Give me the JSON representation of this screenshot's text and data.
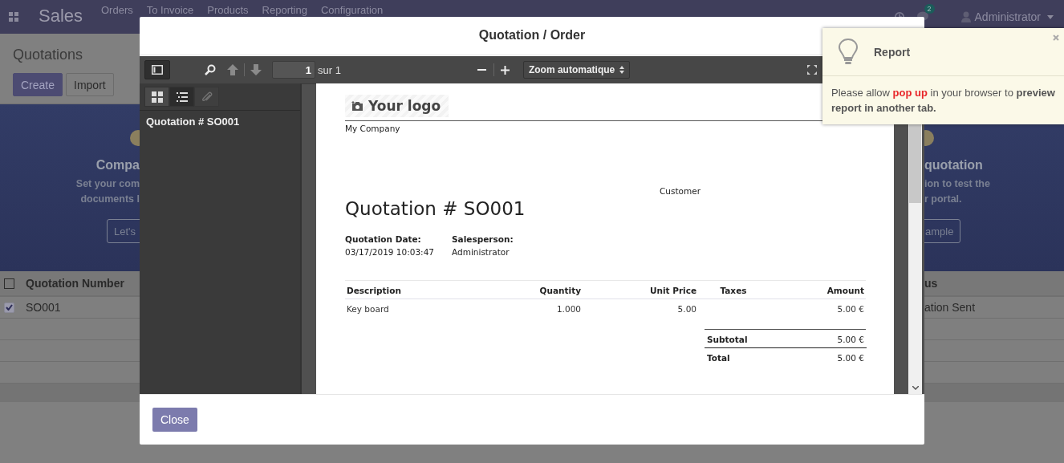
{
  "navbar": {
    "app_name": "Sales",
    "menu": [
      "Orders",
      "To Invoice",
      "Products",
      "Reporting",
      "Configuration"
    ],
    "messages_badge": "2",
    "user": "Administrator"
  },
  "control_panel": {
    "title": "Quotations",
    "buttons": [
      {
        "label": "Create",
        "kind": "primary"
      },
      {
        "label": "Import",
        "kind": "secondary"
      }
    ]
  },
  "banner": {
    "left": {
      "title": "Compa",
      "lines": [
        "Set your com",
        "documents l"
      ],
      "button": "Let's"
    },
    "right": {
      "title": "quotation",
      "lines": [
        "ion to test the",
        "r portal."
      ],
      "button": "ample"
    }
  },
  "list": {
    "select_all": {
      "checked": false
    },
    "column_1": "Quotation Number",
    "column_2": "us",
    "rows": [
      {
        "number": "SO001",
        "status": "ation Sent",
        "checked": true
      }
    ]
  },
  "modal": {
    "title": "Quotation / Order",
    "viewer": {
      "sidebar_open": true,
      "page_number": "1",
      "page_count": "sur 1",
      "zoom": "Zoom automatique",
      "sidebar_tabs": [
        {
          "kind": "thumbnails",
          "selected": false,
          "disabled": false
        },
        {
          "kind": "outline",
          "selected": true,
          "disabled": false
        },
        {
          "kind": "attachments",
          "selected": false,
          "disabled": true
        }
      ],
      "outline": [
        "Quotation # SO001"
      ],
      "document": {
        "logo": "Your logo",
        "company": "My Company",
        "customer_label": "Customer",
        "title": "Quotation # SO001",
        "info": [
          {
            "label": "Quotation Date:",
            "value": "03/17/2019 10:03:47"
          },
          {
            "label": "Salesperson:",
            "value": "Administrator"
          }
        ],
        "columns": [
          "Description",
          "Quantity",
          "Unit Price",
          "Taxes",
          "Amount"
        ],
        "lines": [
          {
            "description": "Key board",
            "quantity": "1.000",
            "unit_price": "5.00",
            "amount": "5.00 €"
          }
        ],
        "totals": [
          {
            "label": "Subtotal",
            "value": "5.00 €"
          },
          {
            "label": "Total",
            "value": "5.00 €"
          }
        ]
      }
    },
    "buttons": [
      "Close"
    ]
  },
  "notification": {
    "title": "Report",
    "message": [
      {
        "text": "Please allow ",
        "kind": "plain"
      },
      {
        "text": "pop up",
        "kind": "alert"
      },
      {
        "text": " in your browser to ",
        "kind": "plain"
      },
      {
        "text": "preview report in another tab.",
        "kind": "strong"
      }
    ]
  }
}
